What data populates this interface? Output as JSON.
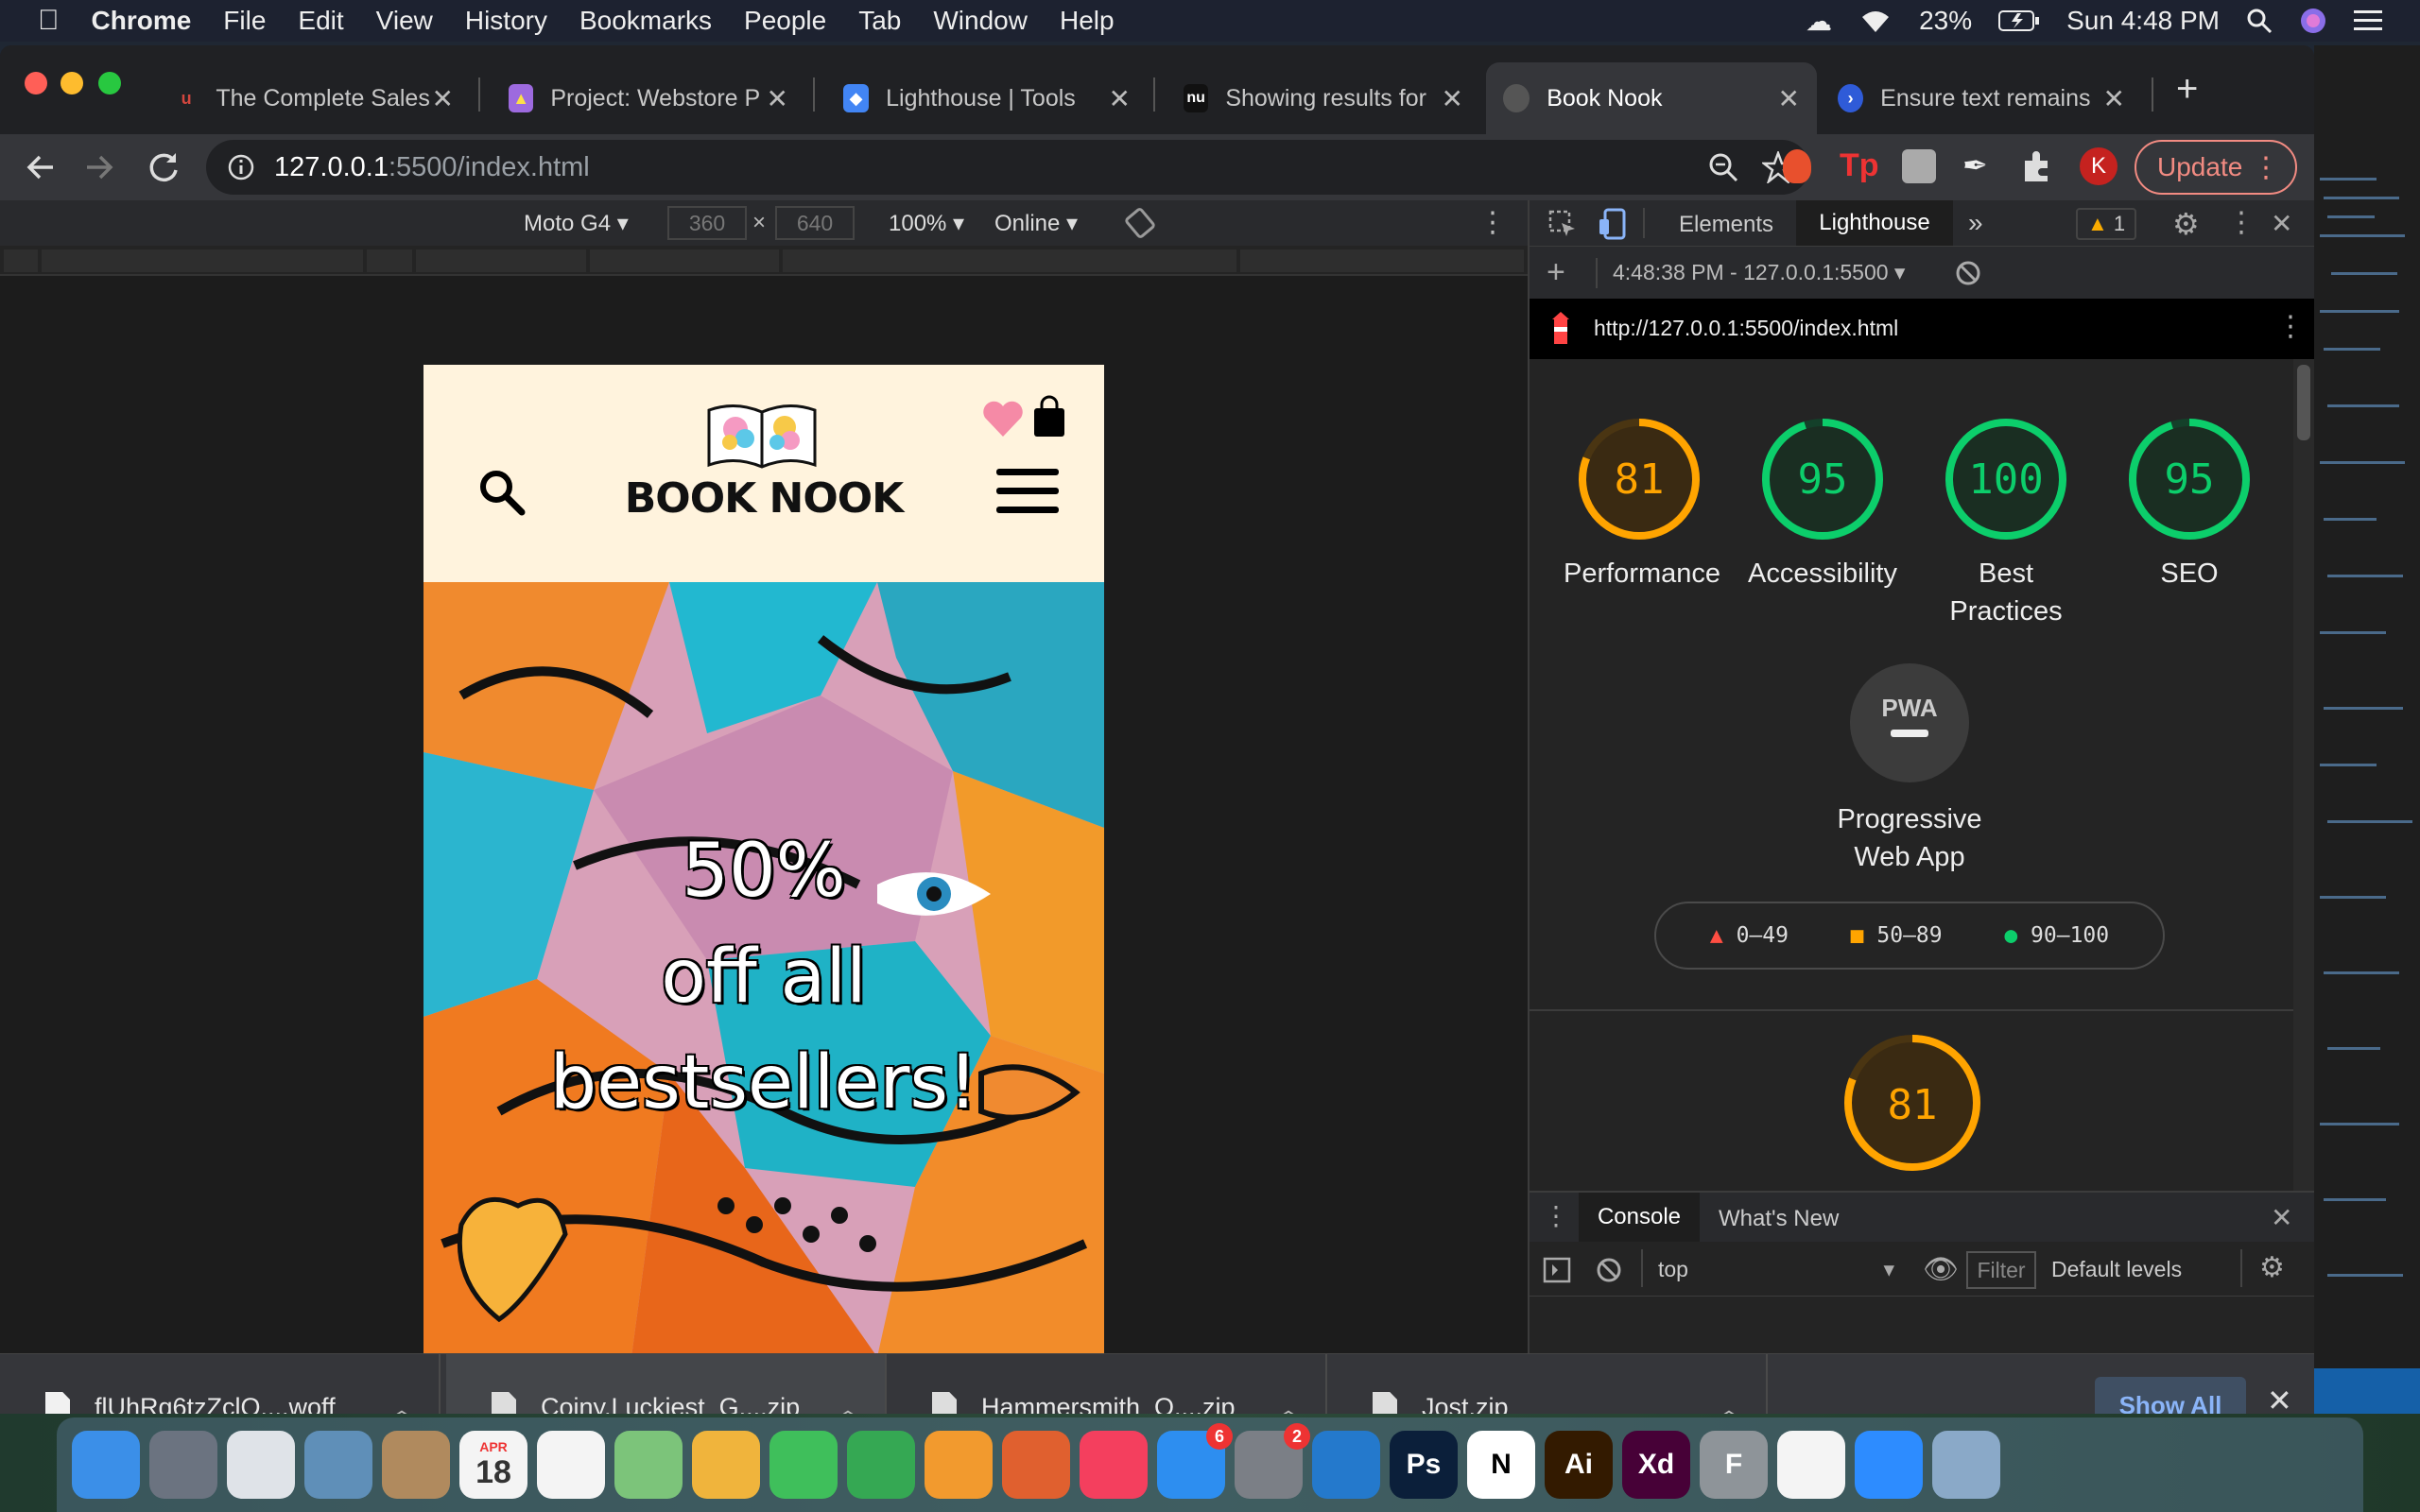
{
  "menubar": {
    "app": "Chrome",
    "items": [
      "File",
      "Edit",
      "View",
      "History",
      "Bookmarks",
      "People",
      "Tab",
      "Window",
      "Help"
    ],
    "battery": "23%",
    "clock": "Sun 4:48 PM"
  },
  "tabs": [
    {
      "title": "The Complete Sales",
      "icon": "udemy-icon",
      "color": "#d2463e"
    },
    {
      "title": "Project: Webstore P",
      "icon": "shopping-bag-icon",
      "color": "#9d6adf"
    },
    {
      "title": "Lighthouse  |  Tools",
      "icon": "lighthouse-icon",
      "color": "#4285f4"
    },
    {
      "title": "Showing results for",
      "icon": "nu-icon",
      "color": "#111111"
    },
    {
      "title": "Book Nook",
      "icon": "globe-icon",
      "color": "#777777"
    },
    {
      "title": "Ensure text remains",
      "icon": "web-dev-icon",
      "color": "#2f5bd8"
    }
  ],
  "address": {
    "host": "127.0.0.1",
    "rest": ":5500/index.html"
  },
  "profile_initial": "K",
  "update_label": "Update",
  "device_toolbar": {
    "device": "Moto G4",
    "width": "360",
    "times": "×",
    "height": "640",
    "zoom": "100%",
    "network": "Online"
  },
  "site": {
    "logo_text": "BOOK NOOK",
    "hero_line1": "50%",
    "hero_line2": "off all",
    "hero_line3": "bestsellers!"
  },
  "devtools": {
    "tab_elements": "Elements",
    "tab_lighthouse": "Lighthouse",
    "warning_count": "1",
    "report_time": "4:48:38 PM - 127.0.0.1:5500",
    "report_url": "http://127.0.0.1:5500/index.html",
    "scores": [
      {
        "value": 81,
        "label_l1": "Performance",
        "label_l2": "",
        "color": "#ffa400",
        "track": "#4a3512",
        "fill": "#3a2a12"
      },
      {
        "value": 95,
        "label_l1": "Accessibility",
        "label_l2": "",
        "color": "#0cce6b",
        "track": "#14402a",
        "fill": "#1a2e22"
      },
      {
        "value": 100,
        "label_l1": "Best",
        "label_l2": "Practices",
        "color": "#0cce6b",
        "track": "#14402a",
        "fill": "#1a2e22"
      },
      {
        "value": 95,
        "label_l1": "SEO",
        "label_l2": "",
        "color": "#0cce6b",
        "track": "#14402a",
        "fill": "#1a2e22"
      }
    ],
    "pwa_badge": "PWA",
    "pwa_label_l1": "Progressive",
    "pwa_label_l2": "Web App",
    "legend": [
      {
        "range": "0–49",
        "shape": "triangle",
        "color": "#ff4e42"
      },
      {
        "range": "50–89",
        "shape": "square",
        "color": "#ffa400"
      },
      {
        "range": "90–100",
        "shape": "circle",
        "color": "#0cce6b"
      }
    ],
    "perf_detail_score": 81,
    "drawer_console": "Console",
    "drawer_whatsnew": "What's New",
    "context": "top",
    "filter_placeholder": "Filter",
    "levels": "Default levels"
  },
  "downloads": [
    {
      "name": "flUhRq6tzZclQ....woff"
    },
    {
      "name": "Coiny,Luckiest_G....zip"
    },
    {
      "name": "Hammersmith_O....zip"
    },
    {
      "name": "Jost.zip"
    }
  ],
  "show_all": "Show All",
  "dock": {
    "calendar_month": "APR",
    "calendar_day": "18",
    "appstore_badge": "6",
    "prefs_badge": "2",
    "apps": [
      {
        "name": "finder",
        "label": "",
        "color": "#3b8fe8"
      },
      {
        "name": "launchpad",
        "label": "",
        "color": "#6b7380"
      },
      {
        "name": "chrome",
        "label": "",
        "color": "#dfe3e8"
      },
      {
        "name": "mail-bird",
        "label": "",
        "color": "#5f8fb8"
      },
      {
        "name": "contacts",
        "label": "",
        "color": "#b08a5e"
      },
      {
        "name": "calendar",
        "label": "",
        "color": "#f4f4f4"
      },
      {
        "name": "reminders",
        "label": "",
        "color": "#f4f4f4"
      },
      {
        "name": "maps",
        "label": "",
        "color": "#7cc47a"
      },
      {
        "name": "photos",
        "label": "",
        "color": "#f0b43c"
      },
      {
        "name": "messages",
        "label": "",
        "color": "#3fbf5b"
      },
      {
        "name": "facetime",
        "label": "",
        "color": "#35a853"
      },
      {
        "name": "pages",
        "label": "",
        "color": "#f29a2e"
      },
      {
        "name": "firefox-dev",
        "label": "",
        "color": "#e0602f"
      },
      {
        "name": "music",
        "label": "",
        "color": "#f43f5e"
      },
      {
        "name": "app-store",
        "label": "",
        "color": "#2d8ef0"
      },
      {
        "name": "system-prefs",
        "label": "",
        "color": "#7b7f86"
      },
      {
        "name": "vscode",
        "label": "",
        "color": "#2479cc"
      },
      {
        "name": "photoshop",
        "label": "Ps",
        "color": "#0b1f3a"
      },
      {
        "name": "notion",
        "label": "N",
        "color": "#ffffff"
      },
      {
        "name": "illustrator",
        "label": "Ai",
        "color": "#331a00"
      },
      {
        "name": "xd",
        "label": "Xd",
        "color": "#470137"
      },
      {
        "name": "fontbase",
        "label": "F",
        "color": "#8e9499"
      },
      {
        "name": "slack",
        "label": "",
        "color": "#f4f4f4"
      },
      {
        "name": "zoom",
        "label": "",
        "color": "#2d8cff"
      },
      {
        "name": "preview",
        "label": "",
        "color": "#8aa9c8"
      }
    ]
  }
}
